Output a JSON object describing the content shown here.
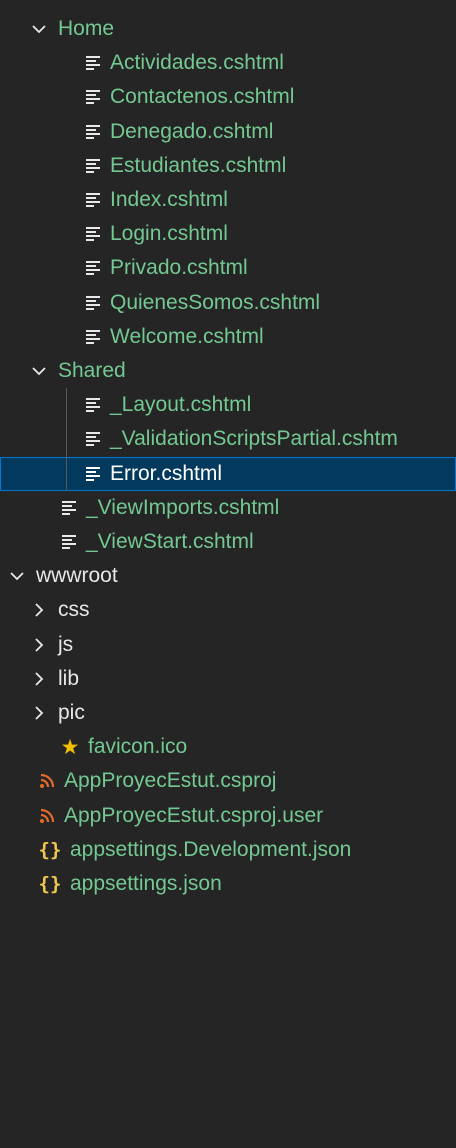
{
  "colors": {
    "background": "#252526",
    "green_text": "#73c991",
    "light_text": "#e8e8e8",
    "selected_bg": "#04395e",
    "selected_border": "#0078d4",
    "selected_text": "#ffffff",
    "star": "#f4c000",
    "rss": "#e66a2b",
    "braces": "#f2c94c"
  },
  "tree": [
    {
      "label": "Home",
      "kind": "folder",
      "expanded": true,
      "depth": 1,
      "color": "green"
    },
    {
      "label": "Actividades.cshtml",
      "kind": "file",
      "icon": "lines-icon",
      "depth": 2,
      "color": "green"
    },
    {
      "label": "Contactenos.cshtml",
      "kind": "file",
      "icon": "lines-icon",
      "depth": 2,
      "color": "green"
    },
    {
      "label": "Denegado.cshtml",
      "kind": "file",
      "icon": "lines-icon",
      "depth": 2,
      "color": "green"
    },
    {
      "label": "Estudiantes.cshtml",
      "kind": "file",
      "icon": "lines-icon",
      "depth": 2,
      "color": "green"
    },
    {
      "label": "Index.cshtml",
      "kind": "file",
      "icon": "lines-icon",
      "depth": 2,
      "color": "green"
    },
    {
      "label": "Login.cshtml",
      "kind": "file",
      "icon": "lines-icon",
      "depth": 2,
      "color": "green"
    },
    {
      "label": "Privado.cshtml",
      "kind": "file",
      "icon": "lines-icon",
      "depth": 2,
      "color": "green"
    },
    {
      "label": "QuienesSomos.cshtml",
      "kind": "file",
      "icon": "lines-icon",
      "depth": 2,
      "color": "green"
    },
    {
      "label": "Welcome.cshtml",
      "kind": "file",
      "icon": "lines-icon",
      "depth": 2,
      "color": "green"
    },
    {
      "label": "Shared",
      "kind": "folder",
      "expanded": true,
      "depth": 1,
      "color": "green"
    },
    {
      "label": "_Layout.cshtml",
      "kind": "file",
      "icon": "lines-icon",
      "depth": 2,
      "color": "green"
    },
    {
      "label": "_ValidationScriptsPartial.cshtm",
      "kind": "file",
      "icon": "lines-icon",
      "depth": 2,
      "color": "green"
    },
    {
      "label": "Error.cshtml",
      "kind": "file",
      "icon": "lines-icon",
      "depth": 2,
      "color": "white",
      "selected": true
    },
    {
      "label": "_ViewImports.cshtml",
      "kind": "file",
      "icon": "lines-icon",
      "depth": 1,
      "color": "green"
    },
    {
      "label": "_ViewStart.cshtml",
      "kind": "file",
      "icon": "lines-icon",
      "depth": 1,
      "color": "green"
    },
    {
      "label": "wwwroot",
      "kind": "folder",
      "expanded": true,
      "depth": 0,
      "color": "light"
    },
    {
      "label": "css",
      "kind": "folder",
      "expanded": false,
      "depth": 1,
      "color": "light"
    },
    {
      "label": "js",
      "kind": "folder",
      "expanded": false,
      "depth": 1,
      "color": "light"
    },
    {
      "label": "lib",
      "kind": "folder",
      "expanded": false,
      "depth": 1,
      "color": "light"
    },
    {
      "label": "pic",
      "kind": "folder",
      "expanded": false,
      "depth": 1,
      "color": "light"
    },
    {
      "label": "favicon.ico",
      "kind": "file",
      "icon": "star-icon",
      "depth": 1,
      "color": "green"
    },
    {
      "label": "AppProyecEstut.csproj",
      "kind": "file",
      "icon": "rss-icon",
      "depth": 0,
      "color": "green"
    },
    {
      "label": "AppProyecEstut.csproj.user",
      "kind": "file",
      "icon": "rss-icon",
      "depth": 0,
      "color": "green"
    },
    {
      "label": "appsettings.Development.json",
      "kind": "file",
      "icon": "braces-icon",
      "depth": 0,
      "color": "green"
    },
    {
      "label": "appsettings.json",
      "kind": "file",
      "icon": "braces-icon",
      "depth": 0,
      "color": "green"
    }
  ]
}
